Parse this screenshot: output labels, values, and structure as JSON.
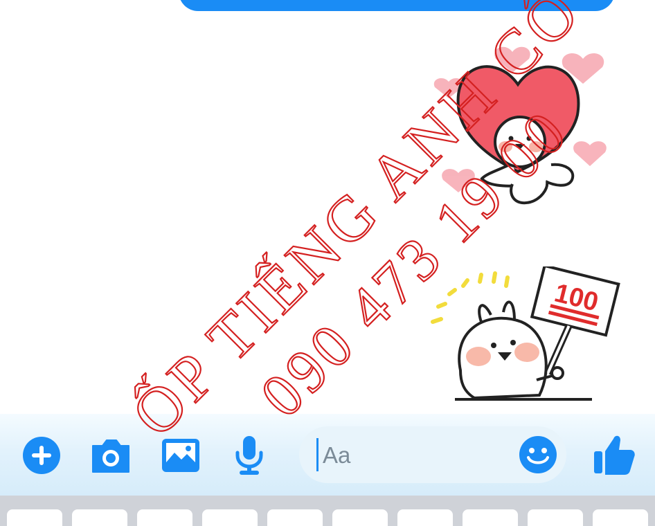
{
  "conversation": {
    "stickers": [
      {
        "name": "heart-sticker",
        "description": "heart"
      },
      {
        "name": "score-100-sticker",
        "sign_text": "100"
      }
    ]
  },
  "composer": {
    "placeholder": "Aa",
    "icons": [
      "plus-icon",
      "camera-icon",
      "gallery-icon",
      "microphone-icon",
      "emoji-icon",
      "thumbs-up-icon"
    ]
  },
  "watermark": {
    "line1": "ỐP TIẾNG ANH CÔ NGÂN",
    "line2": "090 473 19 00"
  },
  "colors": {
    "accent": "#1a8cf5",
    "watermark": "#d42020",
    "heart": "#f05a67",
    "composer_bg": "#dcefff"
  }
}
